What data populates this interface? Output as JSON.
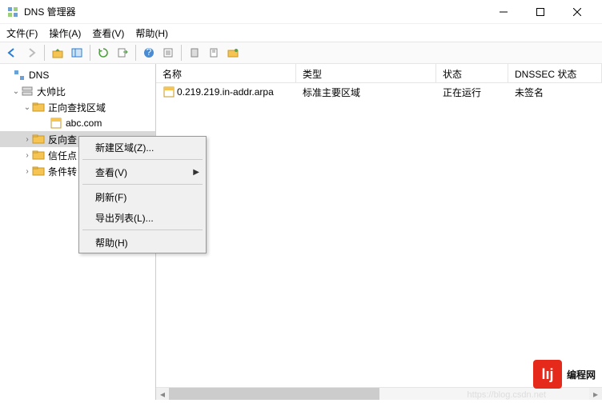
{
  "window": {
    "title": "DNS 管理器"
  },
  "menu": {
    "file": "文件(F)",
    "action": "操作(A)",
    "view": "查看(V)",
    "help": "帮助(H)"
  },
  "tree": {
    "root": "DNS",
    "server": "大帅比",
    "fwd": "正向查找区域",
    "fwd_zone": "abc.com",
    "rev_prefix": "反向查",
    "trust_prefix": "信任点",
    "cond_prefix": "条件转"
  },
  "columns": {
    "name": "名称",
    "type": "类型",
    "status": "状态",
    "dnssec": "DNSSEC 状态"
  },
  "row": {
    "name": "0.219.219.in-addr.arpa",
    "type": "标准主要区域",
    "status": "正在运行",
    "dnssec": "未签名"
  },
  "ctx": {
    "new_zone": "新建区域(Z)...",
    "view": "查看(V)",
    "refresh": "刷新(F)",
    "export": "导出列表(L)...",
    "help": "帮助(H)"
  },
  "watermark": "编程网",
  "faded_url": "https://blog.csdn.net"
}
